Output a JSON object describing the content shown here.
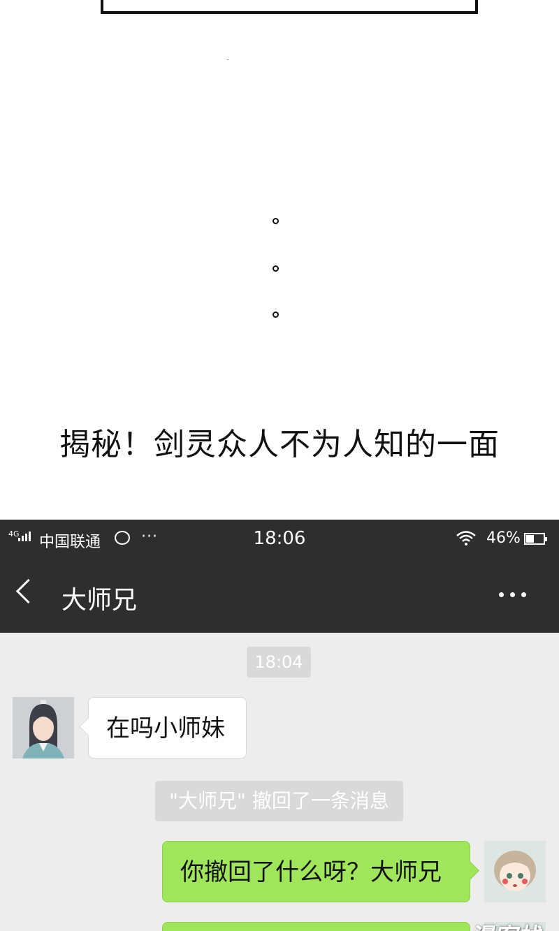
{
  "comic": {
    "ellipsis_dots": [
      "。",
      "。",
      "。"
    ],
    "headline": "揭秘！剑灵众人不为人知的一面"
  },
  "status_bar": {
    "network": "4G",
    "carrier": "中国联通",
    "more": "···",
    "time": "18:06",
    "battery_percent": "46%",
    "battery_level": 0.46
  },
  "nav": {
    "back_icon": "chevron-left-icon",
    "title": "大师兄",
    "menu_icon": "more-dots-icon"
  },
  "chat": {
    "timestamp": "18:04",
    "messages": [
      {
        "from": "大师兄",
        "side": "left",
        "text": "在吗小师妹"
      },
      {
        "type": "system",
        "text": "\"大师兄\" 撤回了一条消息"
      },
      {
        "from": "me",
        "side": "right",
        "text": "你撤回了什么呀？大师兄"
      }
    ]
  },
  "colors": {
    "bar_bg": "#2e2e2e",
    "chat_bg": "#ededed",
    "bubble_out": "#9fe65a",
    "bubble_in": "#ffffff"
  },
  "watermark": "漫客栈"
}
